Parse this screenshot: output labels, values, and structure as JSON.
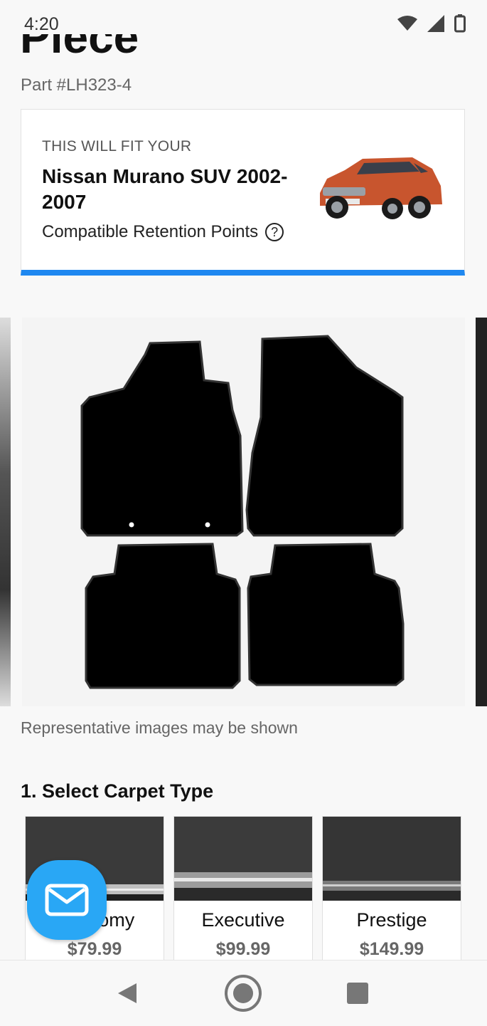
{
  "status": {
    "time": "4:20"
  },
  "product": {
    "title_partial": "Piece",
    "part_number": "Part #LH323-4"
  },
  "fit_card": {
    "label": "THIS WILL FIT YOUR",
    "vehicle": "Nissan Murano SUV 2002-2007",
    "retention": "Compatible Retention Points",
    "help_symbol": "?"
  },
  "gallery": {
    "caption": "Representative images may be shown"
  },
  "carpet_section": {
    "heading": "1. Select Carpet Type",
    "options": [
      {
        "name": "Economy",
        "price": "$79.99"
      },
      {
        "name": "Executive",
        "price": "$99.99"
      },
      {
        "name": "Prestige",
        "price": "$149.99"
      }
    ]
  },
  "colors": {
    "accent_blue": "#1e88f0",
    "fab_blue": "#29a7f5"
  }
}
